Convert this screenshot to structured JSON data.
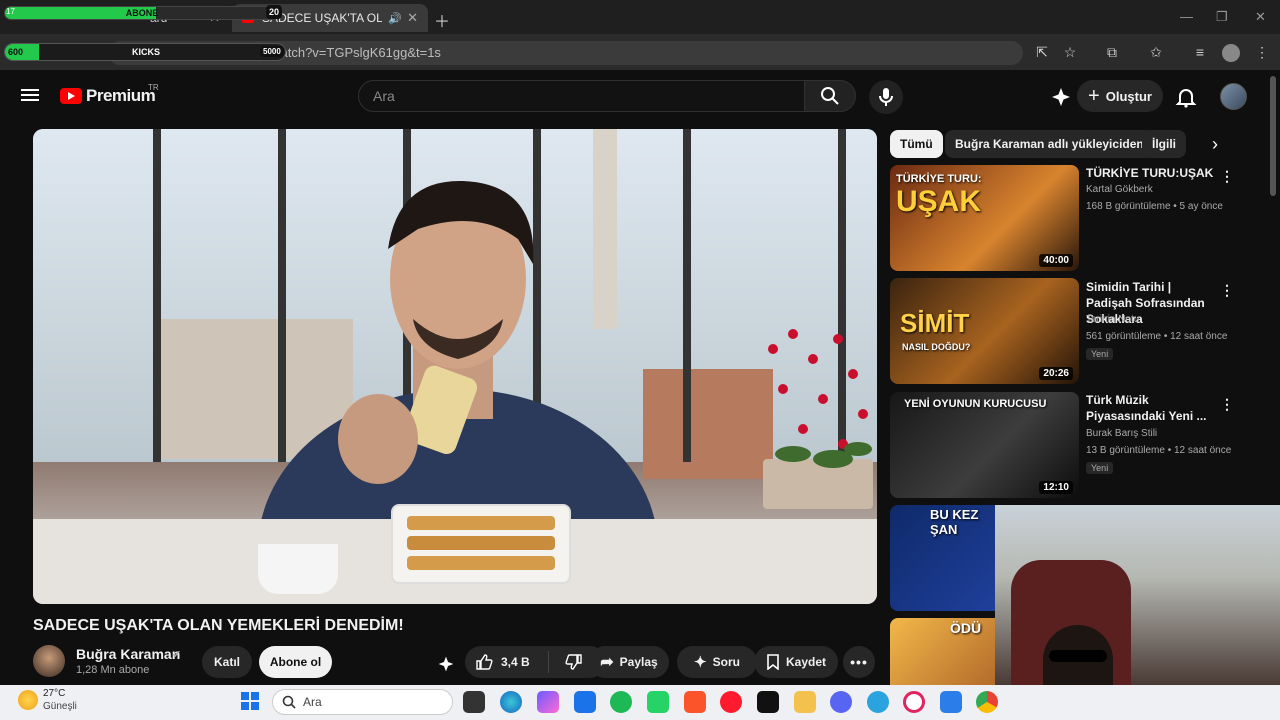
{
  "browser": {
    "tabs": [
      {
        "label": "ard"
      },
      {
        "label": "SADECE UŞAK'TA OLAN YE"
      }
    ],
    "url": "www.youtube.com/watch?v=TGPslgK61gg&t=1s",
    "overlay_top": {
      "label": "ABONE",
      "count": "20",
      "left": "17",
      "progress": 0.55
    },
    "overlay_bar": {
      "label": "KICKS",
      "left": "600",
      "right": "5000",
      "progress": 0.12
    }
  },
  "youtube": {
    "logo": "Premium",
    "country": "TR",
    "search_placeholder": "Ara",
    "create_label": "Oluştur"
  },
  "video": {
    "title": "SADECE UŞAK'TA OLAN YEMEKLERİ DENEDİM!",
    "channel": "Buğra Karaman",
    "subscribers": "1,28 Mn abone",
    "join_label": "Katıl",
    "subscribe_label": "Abone ol",
    "likes": "3,4 B",
    "share_label": "Paylaş",
    "ask_label": "Soru",
    "save_label": "Kaydet"
  },
  "chips": [
    "Tümü",
    "Buğra Karaman adlı yükleyiciden",
    "İlgili"
  ],
  "recommendations": [
    {
      "title": "TÜRKİYE TURU:UŞAK",
      "channel": "Kartal Gökberk",
      "meta": "168 B görüntüleme • 5 ay önce",
      "duration": "40:00",
      "thumb_text": "UŞAK",
      "thumb_sub": "TÜRKİYE TURU:",
      "badge": ""
    },
    {
      "title": "Simidin Tarihi | Padişah Sofrasından Sokaklara",
      "channel": "Tarihin Notu",
      "meta": "561 görüntüleme • 12 saat önce",
      "duration": "20:26",
      "thumb_text": "SİMİT",
      "thumb_sub": "NASIL DOĞDU?",
      "badge": "Yeni"
    },
    {
      "title": "Türk Müzik Piyasasındaki Yeni ...",
      "channel": "Burak Barış Stili",
      "meta": "13 B görüntüleme • 12 saat önce",
      "duration": "12:10",
      "thumb_text": "YENİ OYUNUN KURUCUSU",
      "thumb_sub": "",
      "badge": "Yeni"
    }
  ],
  "partials": [
    {
      "text": "BU KEZ ŞAN"
    },
    {
      "text": "ÖDÜ"
    }
  ],
  "taskbar": {
    "temp": "27°C",
    "weather": "Güneşli",
    "search": "Ara"
  }
}
